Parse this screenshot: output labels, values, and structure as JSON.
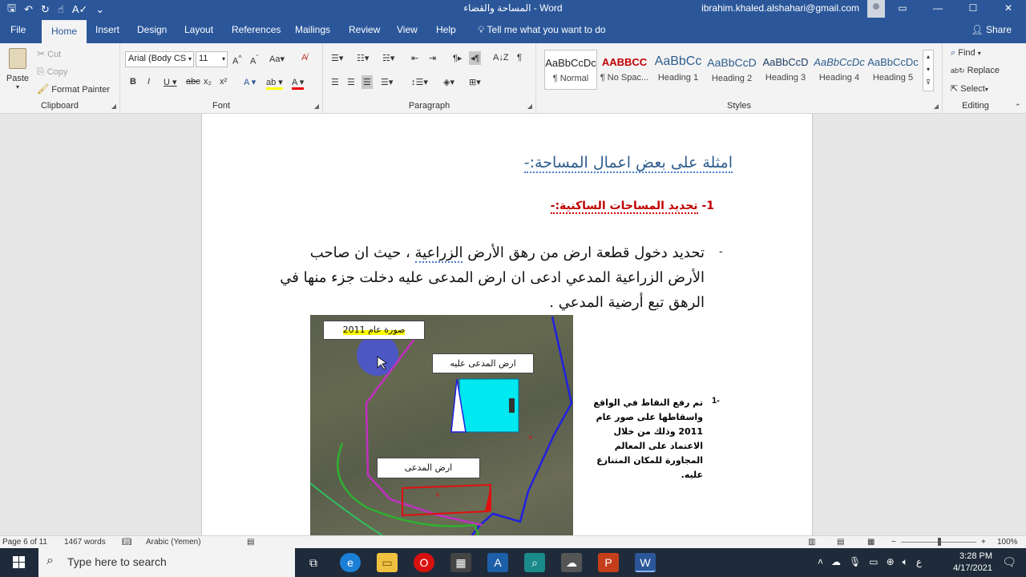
{
  "window": {
    "title": "المساحة والقضاء  -  Word",
    "user_email": "ibrahim.khaled.alshahari@gmail.com"
  },
  "tabs": [
    "File",
    "Home",
    "Insert",
    "Design",
    "Layout",
    "References",
    "Mailings",
    "Review",
    "View",
    "Help"
  ],
  "tell_me": "Tell me what you want to do",
  "share": "Share",
  "clipboard": {
    "paste": "Paste",
    "cut": "Cut",
    "copy": "Copy",
    "format_painter": "Format Painter",
    "label": "Clipboard"
  },
  "font": {
    "name": "Arial (Body CS",
    "size": "11",
    "label": "Font"
  },
  "paragraph": {
    "label": "Paragraph"
  },
  "styles": {
    "label": "Styles",
    "items": [
      {
        "sample": "AaBbCcDc",
        "name": "¶ Normal"
      },
      {
        "sample": "AABBCC",
        "name": "¶ No Spac..."
      },
      {
        "sample": "AaBbCc",
        "name": "Heading 1"
      },
      {
        "sample": "AaBbCcD",
        "name": "Heading 2"
      },
      {
        "sample": "AaBbCcD",
        "name": "Heading 3"
      },
      {
        "sample": "AaBbCcDc",
        "name": "Heading 4"
      },
      {
        "sample": "AaBbCcDc",
        "name": "Heading 5"
      }
    ]
  },
  "editing": {
    "find": "Find",
    "replace": "Replace",
    "select": "Select",
    "label": "Editing"
  },
  "document": {
    "heading1": "امثلة على بعض اعمال المساحة:-",
    "heading2_number": "1-",
    "heading2": "تحديد المساحات الساكنية:-",
    "para_line1_a": "تحديد دخول قطعة ارض من رهق الأرض ",
    "para_line1_squig": "الزراعية",
    "para_line1_b": " ، حيث ان صاحب",
    "para_line2": "الأرض الزراعية المدعي ادعى ان ارض المدعى عليه دخلت جزء منها في",
    "para_line3": "الرهق تبع أرضية المدعي .",
    "map_label_year": "صورة عام 2011",
    "map_label_defendant": "ارض المدعى عليه",
    "map_label_plaintiff": "ارض المدعى",
    "caption_number": "1-",
    "caption": "تم رفع النقاط في الواقع واسقاطها على صور عام 2011 وذلك من خلال الاعتماد على المعالم المجاورة للمكان المتنازع عليه."
  },
  "status": {
    "page": "Page 6 of 11",
    "words": "1467 words",
    "language": "Arabic (Yemen)",
    "zoom": "100%"
  },
  "taskbar": {
    "search_placeholder": "Type here to search",
    "time": "3:28 PM",
    "date": "4/17/2021",
    "lang": "ع"
  }
}
